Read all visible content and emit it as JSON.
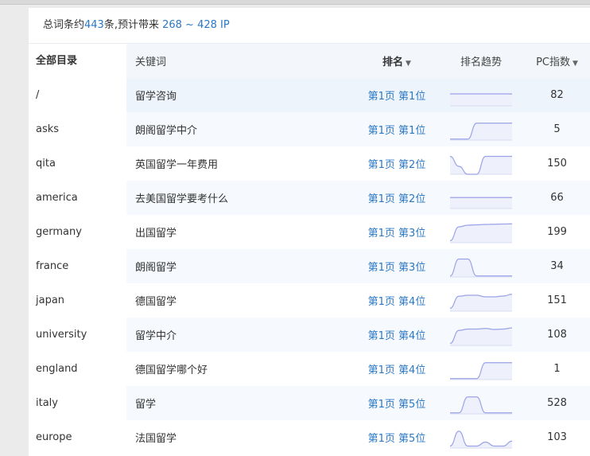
{
  "summary": {
    "prefix": "总词条约",
    "count": "443",
    "mid": "条,预计带来 ",
    "ip_range": "268 ~ 428 IP"
  },
  "directory": {
    "header": "全部目录",
    "items": [
      "/",
      "asks",
      "qita",
      "america",
      "germany",
      "france",
      "japan",
      "university",
      "england",
      "italy",
      "europe"
    ]
  },
  "table": {
    "headers": {
      "keyword": "关键词",
      "rank": "排名",
      "trend": "排名趋势",
      "pc_index": "PC指数"
    },
    "sort_icon": "caret-down-icon",
    "rows": [
      {
        "keyword": "留学咨询",
        "rank": "第1页 第1位",
        "pc": "82",
        "trend": [
          0.6,
          0.6,
          0.6,
          0.6,
          0.6,
          0.6,
          0.6,
          0.6
        ]
      },
      {
        "keyword": "朗阁留学中介",
        "rank": "第1页 第1位",
        "pc": "5",
        "trend": [
          0.05,
          0.05,
          0.05,
          0.85,
          0.85,
          0.85,
          0.85,
          0.85
        ]
      },
      {
        "keyword": "英国留学一年费用",
        "rank": "第1页 第2位",
        "pc": "150",
        "trend": [
          0.9,
          0.4,
          0.0,
          0.0,
          0.9,
          0.9,
          0.9,
          0.9
        ]
      },
      {
        "keyword": "去美国留学要考什么",
        "rank": "第1页 第2位",
        "pc": "66",
        "trend": [
          0.55,
          0.55,
          0.55,
          0.55,
          0.55,
          0.55,
          0.55,
          0.55
        ]
      },
      {
        "keyword": "出国留学",
        "rank": "第1页 第3位",
        "pc": "199",
        "trend": [
          0.1,
          0.8,
          0.88,
          0.9,
          0.92,
          0.93,
          0.94,
          0.95
        ]
      },
      {
        "keyword": "朗阁留学",
        "rank": "第1页 第3位",
        "pc": "34",
        "trend": [
          0.05,
          0.9,
          0.9,
          0.05,
          0.05,
          0.05,
          0.05,
          0.05
        ]
      },
      {
        "keyword": "德国留学",
        "rank": "第1页 第4位",
        "pc": "151",
        "trend": [
          0.15,
          0.75,
          0.8,
          0.8,
          0.72,
          0.72,
          0.76,
          0.85
        ]
      },
      {
        "keyword": "留学中介",
        "rank": "第1页 第4位",
        "pc": "108",
        "trend": [
          0.1,
          0.75,
          0.82,
          0.82,
          0.85,
          0.8,
          0.82,
          0.88
        ]
      },
      {
        "keyword": "德国留学哪个好",
        "rank": "第1页 第4位",
        "pc": "1",
        "trend": [
          0.05,
          0.05,
          0.05,
          0.05,
          0.85,
          0.85,
          0.85,
          0.85
        ]
      },
      {
        "keyword": "留学",
        "rank": "第1页 第5位",
        "pc": "528",
        "trend": [
          0.05,
          0.05,
          0.85,
          0.85,
          0.05,
          0.05,
          0.05,
          0.05
        ]
      },
      {
        "keyword": "法国留学",
        "rank": "第1页 第5位",
        "pc": "103",
        "trend": [
          0.1,
          0.85,
          0.1,
          0.1,
          0.3,
          0.1,
          0.1,
          0.35
        ]
      }
    ]
  },
  "colors": {
    "accent": "#2b78c4",
    "spark_line": "#9aa2e8",
    "spark_fill": "#eef0fb",
    "row_alt": "#f6f9fd"
  }
}
